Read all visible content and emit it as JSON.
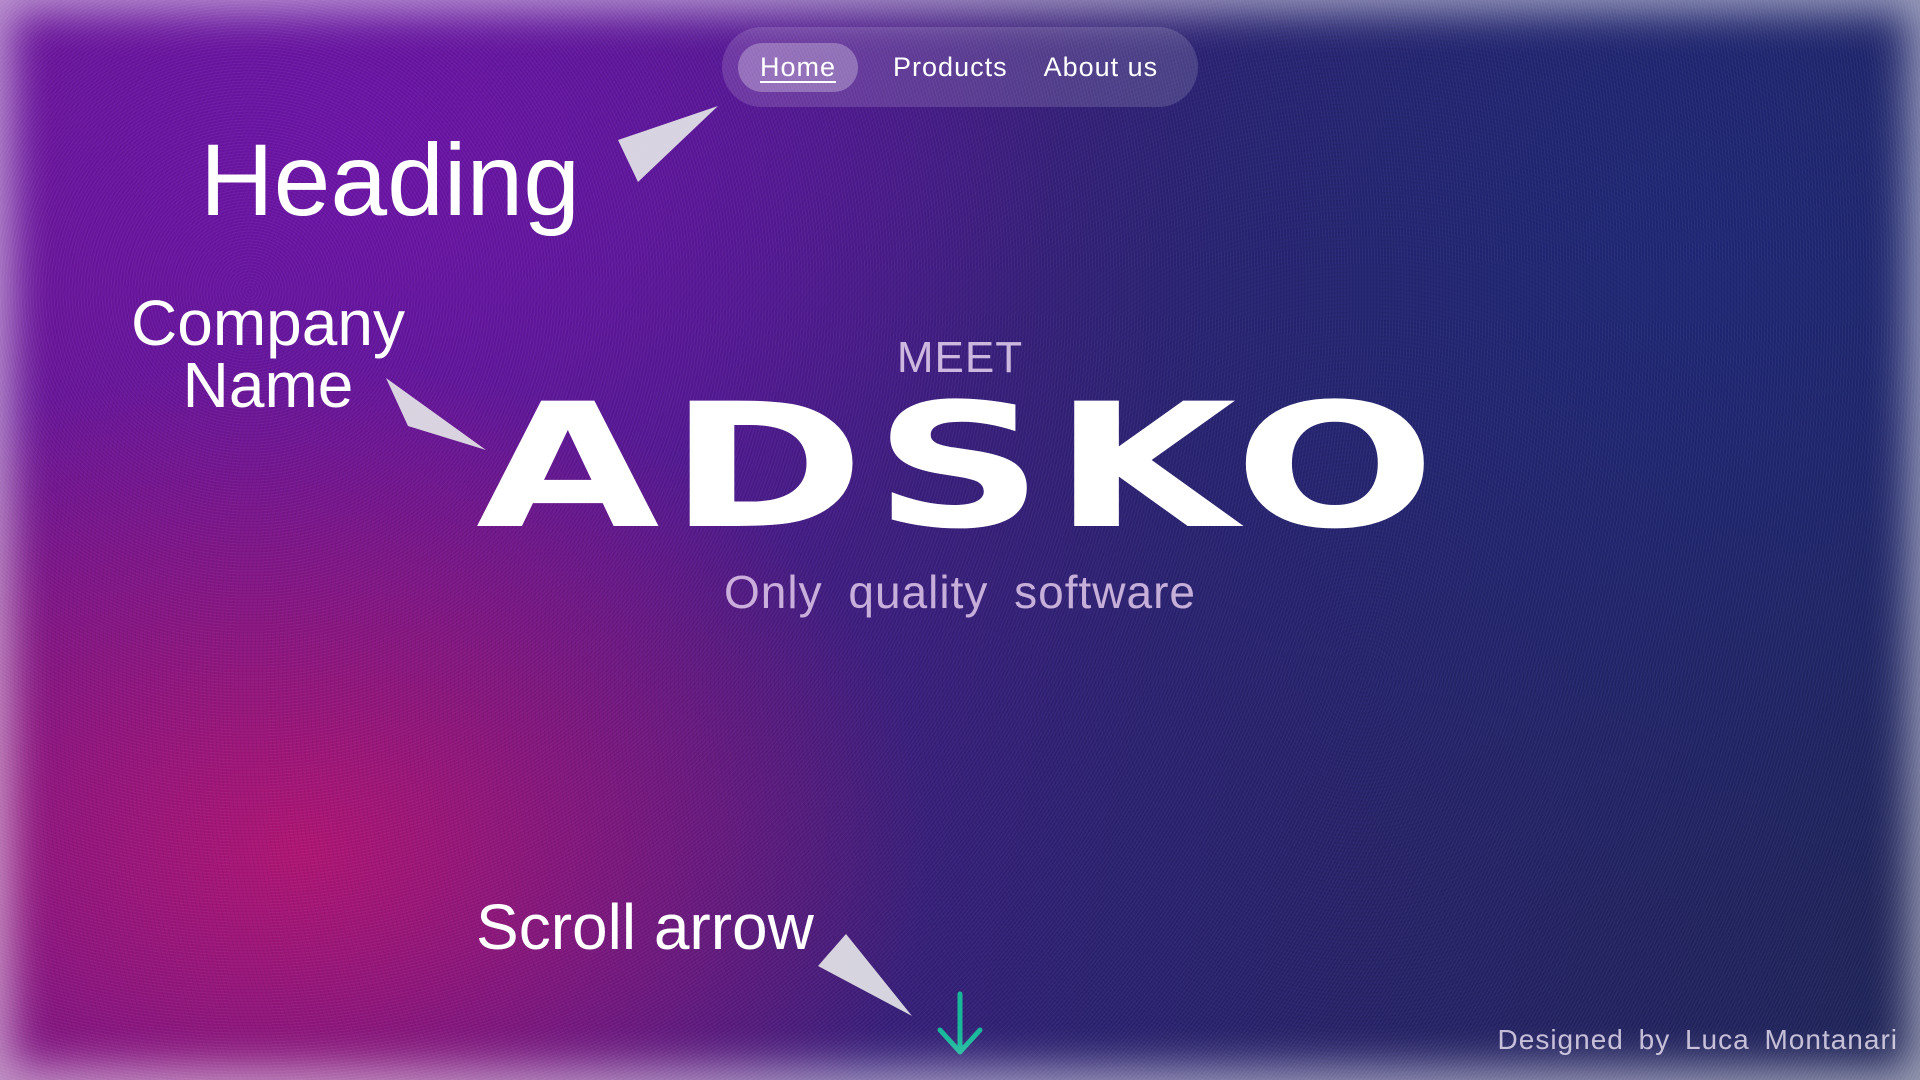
{
  "nav": {
    "items": [
      {
        "label": "Home",
        "active": true
      },
      {
        "label": "Products",
        "active": false
      },
      {
        "label": "About us",
        "active": false
      }
    ]
  },
  "hero": {
    "eyebrow": "MEET",
    "brand": "ADSKO",
    "tagline": "Only quality software"
  },
  "annotations": {
    "heading": "Heading",
    "company_name_line1": "Company",
    "company_name_line2": "Name",
    "scroll_arrow": "Scroll arrow"
  },
  "scroll": {
    "icon": "arrow-down-icon",
    "color": "#17b89a"
  },
  "footer": {
    "credit": "Designed by Luca Montanari"
  },
  "colors": {
    "magenta": "#be146e",
    "purple": "#6a1690",
    "navy": "#1e2458",
    "accent_teal": "#17b89a"
  }
}
